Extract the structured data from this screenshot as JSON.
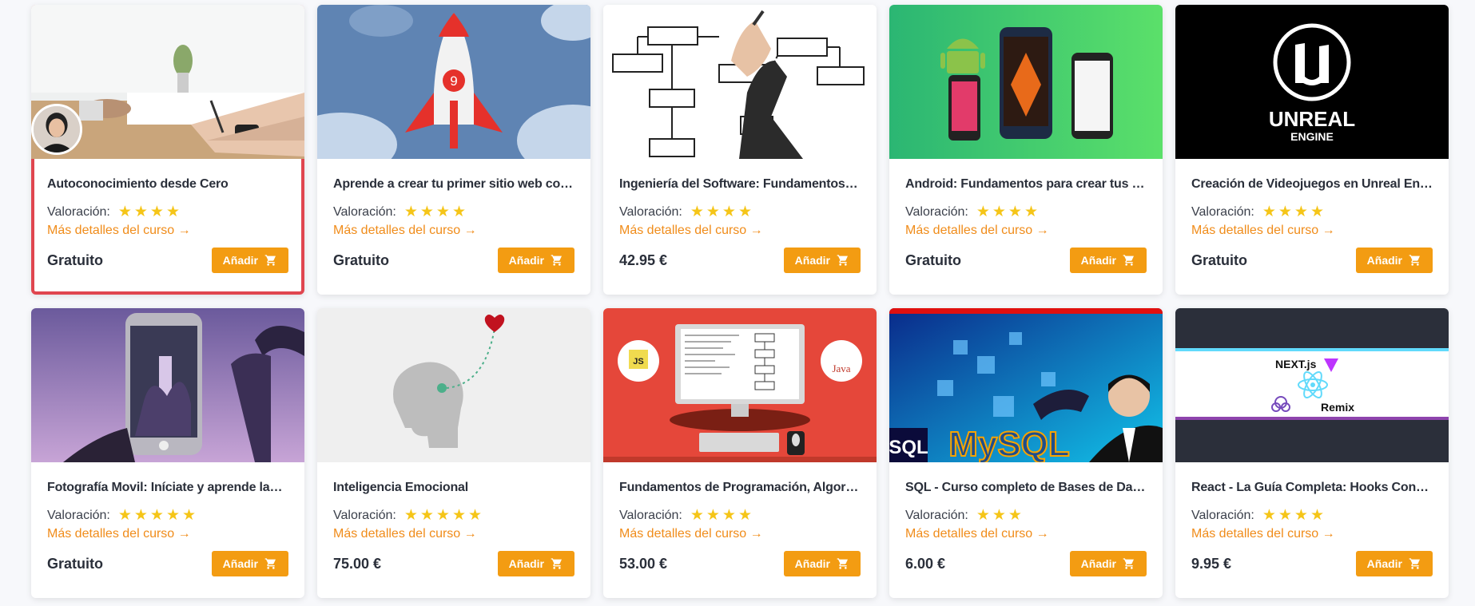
{
  "rating_label": "Valoración:",
  "details_link": "Más detalles del curso →",
  "add_label": "Añadir",
  "courses": [
    {
      "title": "Autoconocimiento desde Cero",
      "stars": "★★★★",
      "price": "Gratuito"
    },
    {
      "title": "Aprende a crear tu primer sitio web con L...",
      "stars": "★★★★",
      "price": "Gratuito"
    },
    {
      "title": "Ingeniería del Software: Fundamentos de ...",
      "stars": "★★★★",
      "price": "42.95 €"
    },
    {
      "title": "Android: Fundamentos para crear tus prim...",
      "stars": "★★★★",
      "price": "Gratuito"
    },
    {
      "title": "Creación de Videojuegos en Unreal Engine...",
      "stars": "★★★★",
      "price": "Gratuito"
    },
    {
      "title": "Fotografía Movil: Iníciate y aprende las ba...",
      "stars": "★★★★★",
      "price": "Gratuito"
    },
    {
      "title": "Inteligencia Emocional",
      "stars": "★★★★★",
      "price": "75.00 €"
    },
    {
      "title": "Fundamentos de Programación, Algoritmo...",
      "stars": "★★★★",
      "price": "53.00 €"
    },
    {
      "title": "SQL - Curso completo de Bases de Datos -...",
      "stars": "★★★",
      "price": "6.00 €"
    },
    {
      "title": "React - La Guía Completa: Hooks Context ...",
      "stars": "★★★★",
      "price": "9.95 €"
    }
  ],
  "thumb_text": {
    "rocket_number": "9",
    "unreal_top": "UNREAL",
    "unreal_bottom": "ENGINE",
    "js_badge": "JS",
    "java_badge": "Java",
    "sql_left": "SQL",
    "mysql": "MySQL",
    "next": "NEXT.js",
    "remix": "Remix"
  },
  "colors": {
    "accent": "#f39c12",
    "link": "#f08c1a",
    "star": "#f5c518",
    "highlight": "#e0464f"
  }
}
